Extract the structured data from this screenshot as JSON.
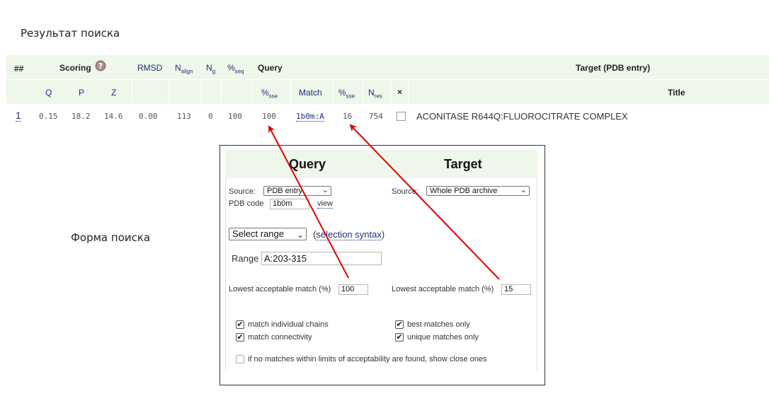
{
  "page": {
    "result_title": "Результат поиска",
    "form_label": "Форма поиска"
  },
  "table": {
    "header1": {
      "num": "##",
      "scoring": "Scoring",
      "rmsd": "RMSD",
      "nalign": "N",
      "nalign_sub": "align",
      "ng": "N",
      "ng_sub": "g",
      "pseq": "%",
      "pseq_sub": "seq",
      "query": "Query",
      "target": "Target (PDB entry)"
    },
    "header2": {
      "q": "Q",
      "p": "P",
      "z": "Z",
      "psse_q": "%",
      "psse_q_sub": "sse",
      "match": "Match",
      "psse_t": "%",
      "psse_t_sub": "sse",
      "nres": "N",
      "nres_sub": "res",
      "x": "×",
      "title": "Title"
    },
    "row": {
      "num": "1",
      "q": "0.15",
      "p": "18.2",
      "z": "14.6",
      "rmsd": "0.00",
      "nalign": "113",
      "ng": "0",
      "pseq": "100",
      "psse_q": "100",
      "match": "1b0m:A",
      "psse_t": "16",
      "nres": "754",
      "title": "ACONITASE R644Q:FLUOROCITRATE COMPLEX"
    }
  },
  "form": {
    "query_title": "Query",
    "target_title": "Target",
    "query_source_label": "Source:",
    "query_source_value": "PDB entry",
    "pdb_code_label": "PDB code",
    "pdb_code_value": "1b0m",
    "view_link": "view",
    "target_source_label": "Source:",
    "target_source_value": "Whole PDB archive",
    "select_range_value": "Select range",
    "syntax_open": "(",
    "syntax_link": "selection syntax",
    "syntax_close": ")",
    "range_label": "Range",
    "range_value": "A:203-315",
    "query_lowest_label": "Lowest acceptable match (%)",
    "query_lowest_value": "100",
    "target_lowest_label": "Lowest acceptable match (%)",
    "target_lowest_value": "15",
    "opt_individual_chains": "match individual chains",
    "opt_connectivity": "match connectivity",
    "opt_best_only": "best matches only",
    "opt_unique_only": "unique matches only",
    "opt_close_ones": "if no matches within limits of acceptability are found, show close ones"
  },
  "colors": {
    "header_bg": "#eef7e9",
    "link": "#1d2f7a",
    "arrow": "#e00000"
  }
}
